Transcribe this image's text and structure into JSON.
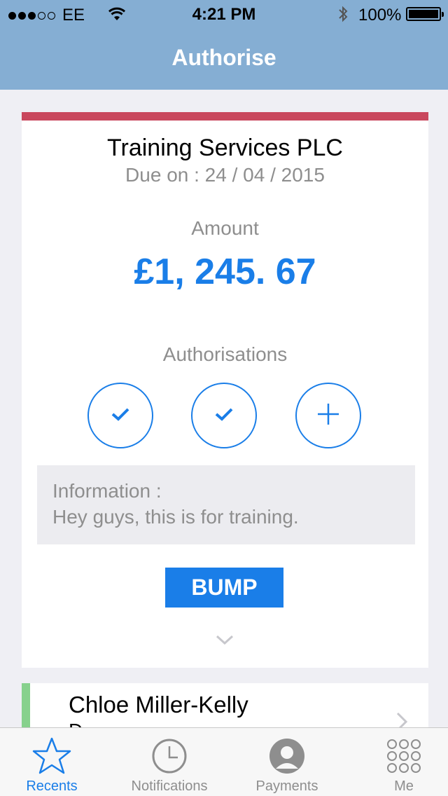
{
  "status_bar": {
    "carrier": "EE",
    "time": "4:21 PM",
    "battery": "100%"
  },
  "nav": {
    "title": "Authorise"
  },
  "card": {
    "accent_color": "#c9475d",
    "company": "Training Services PLC",
    "due": "Due on : 24 / 04 / 2015",
    "amount_label": "Amount",
    "amount": "£1, 245. 67",
    "authorisations_label": "Authorisations",
    "authorisations": [
      {
        "state": "approved",
        "icon": "check-icon"
      },
      {
        "state": "approved",
        "icon": "check-icon"
      },
      {
        "state": "add",
        "icon": "plus-icon"
      }
    ],
    "info_title": "Information :",
    "info_text": "Hey guys, this is for training.",
    "bump_label": "BUMP",
    "expand_icon": "chevron-down-icon"
  },
  "next_card": {
    "accent_color": "#87d18d",
    "name": "Chloe Miller-Kelly",
    "subtitle": "D"
  },
  "tabbar": {
    "tabs": [
      {
        "label": "Recents",
        "icon": "star-icon",
        "active": true
      },
      {
        "label": "Notifications",
        "icon": "clock-icon",
        "active": false
      },
      {
        "label": "Payments",
        "icon": "person-icon",
        "active": false
      },
      {
        "label": "Me",
        "icon": "grid-icon",
        "active": false
      }
    ]
  },
  "colors": {
    "nav_bar": "#85aed3",
    "accent": "#1a7ee8",
    "background": "#efeff4"
  }
}
